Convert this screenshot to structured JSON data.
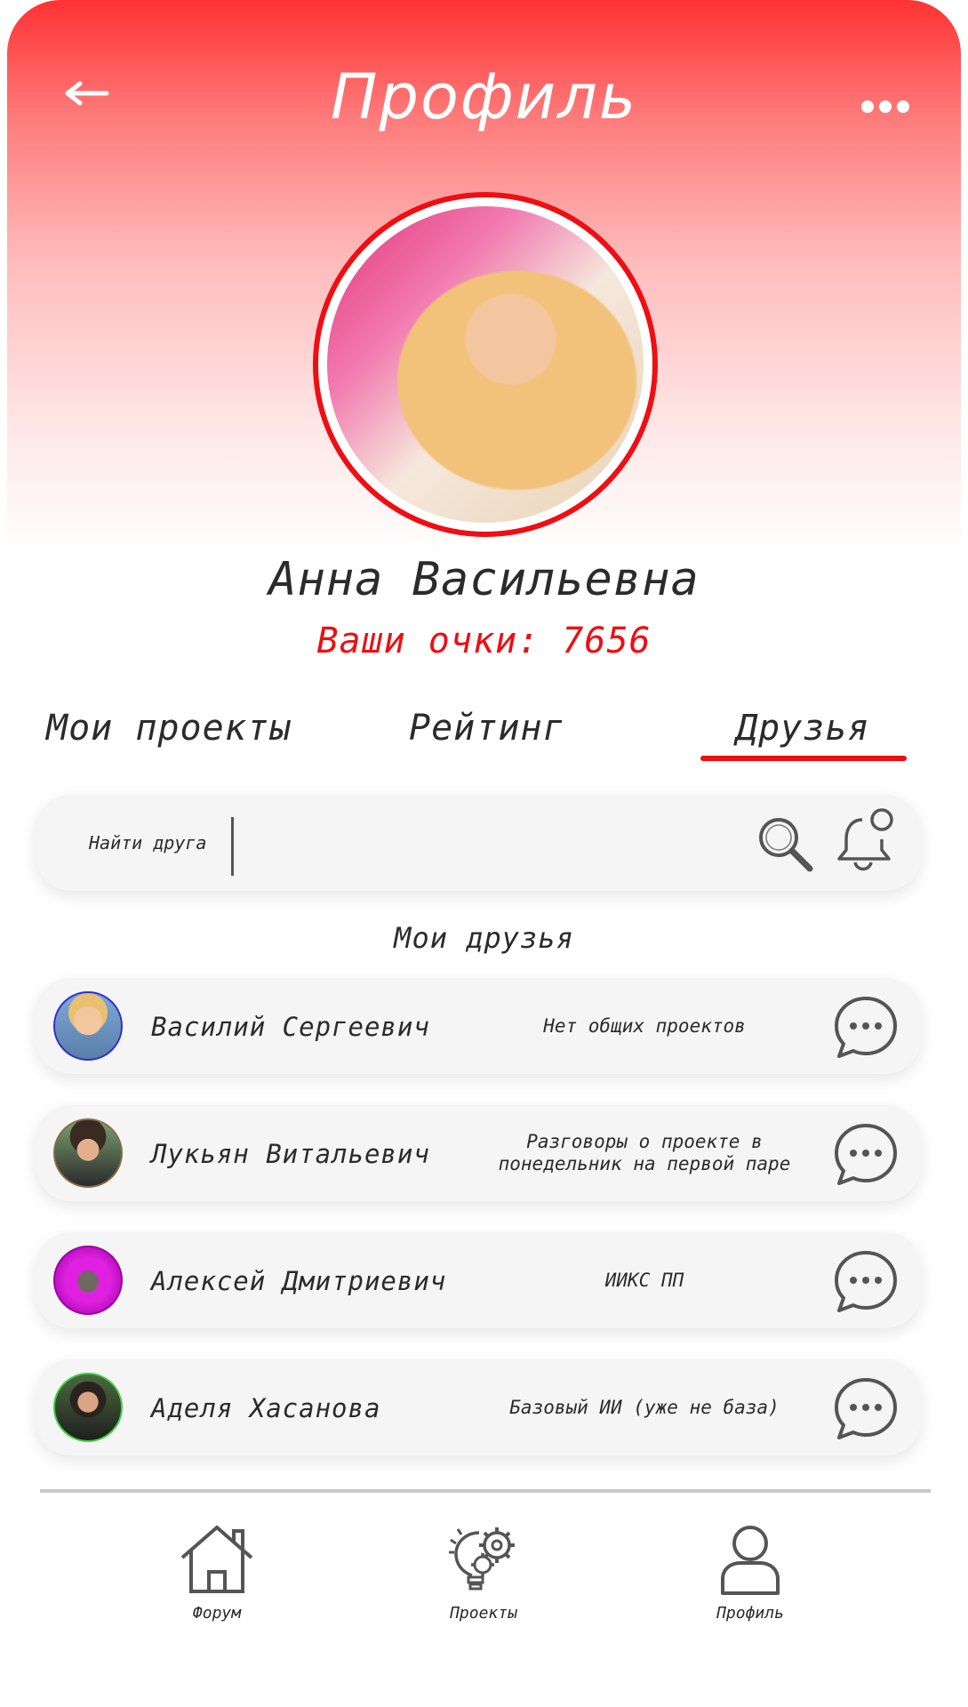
{
  "header": {
    "title": "Профиль",
    "back_icon": "arrow-left-icon",
    "more_icon": "more-dots-icon"
  },
  "profile": {
    "name": "Анна Васильевна",
    "points_text": "Ваши очки: 7656",
    "accent_color": "#ee0e13"
  },
  "tabs": [
    {
      "label": "Мои проекты",
      "active": false
    },
    {
      "label": "Рейтинг",
      "active": false
    },
    {
      "label": "Друзья",
      "active": true
    }
  ],
  "search": {
    "placeholder": "Найти друга",
    "search_icon": "search-icon",
    "bell_icon": "bell-icon"
  },
  "friends_section": {
    "title": "Мои друзья",
    "friends": [
      {
        "name": "Василий Сергеевич",
        "note": "Нет общих проектов",
        "avatar_border": "#2f2fc9"
      },
      {
        "name": "Лукьян Витальевич",
        "note": "Разговоры о проекте в понедельник на первой паре",
        "avatar_border": "#8b6a4a"
      },
      {
        "name": "Алексей Дмитриевич",
        "note": "ИИКС ПП",
        "avatar_border": "#a000a0"
      },
      {
        "name": "Аделя Хасанова",
        "note": "Базовый ИИ (уже не база)",
        "avatar_border": "#3ccf3c"
      }
    ]
  },
  "bottom_nav": [
    {
      "label": "Форум",
      "icon": "home-icon"
    },
    {
      "label": "Проекты",
      "icon": "gears-bulb-icon"
    },
    {
      "label": "Профиль",
      "icon": "user-icon"
    }
  ]
}
